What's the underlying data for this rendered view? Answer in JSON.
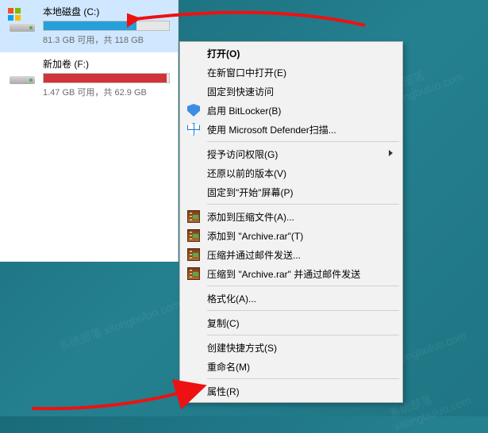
{
  "watermark_text": "系统部落 xitongbuluo.com",
  "drives": [
    {
      "name": "本地磁盘 (C:)",
      "free": "81.3 GB 可用",
      "sep": "，共 ",
      "total": "118 GB",
      "fill_pct": 74,
      "color": "blue",
      "selected": true,
      "os": true
    },
    {
      "name": "新加卷 (F:)",
      "free": "1.47 GB 可用",
      "sep": "，共 ",
      "total": "62.9 GB",
      "fill_pct": 98,
      "color": "red",
      "selected": false,
      "os": false
    }
  ],
  "menu": {
    "open": "打开(O)",
    "open_new_window": "在新窗口中打开(E)",
    "pin_quick": "固定到快速访问",
    "bitlocker": "启用 BitLocker(B)",
    "defender": "使用 Microsoft Defender扫描...",
    "grant_access": "授予访问权限(G)",
    "restore_versions": "还原以前的版本(V)",
    "pin_start": "固定到\"开始\"屏幕(P)",
    "rar_add": "添加到压缩文件(A)...",
    "rar_add_archive": "添加到 \"Archive.rar\"(T)",
    "rar_email": "压缩并通过邮件发送...",
    "rar_email_archive": "压缩到 \"Archive.rar\" 并通过邮件发送",
    "format": "格式化(A)...",
    "copy": "复制(C)",
    "create_shortcut": "创建快捷方式(S)",
    "rename": "重命名(M)",
    "properties": "属性(R)"
  }
}
